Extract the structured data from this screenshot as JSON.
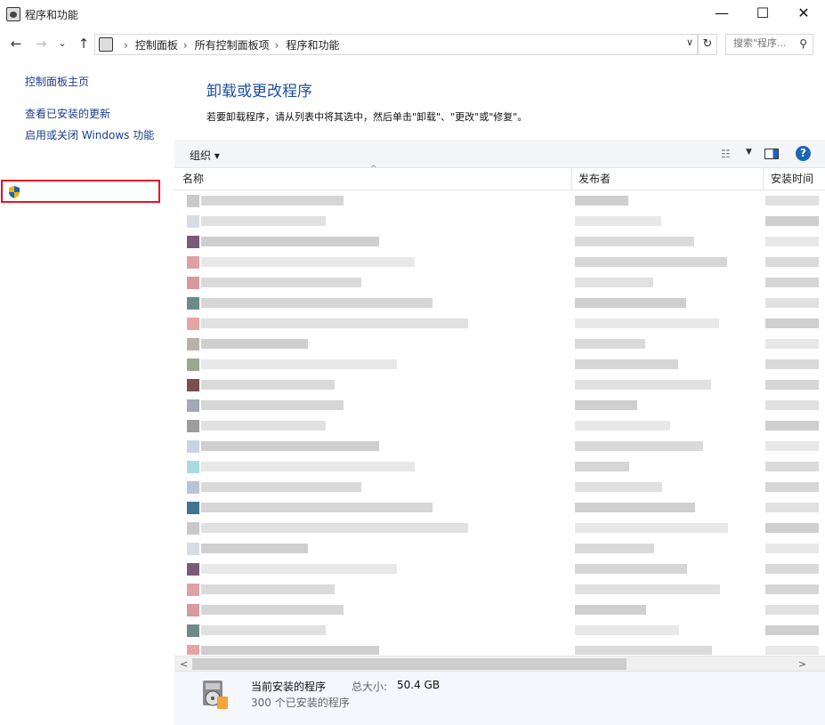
{
  "window": {
    "title": "程序和功能",
    "minimize_glyph": "—",
    "maximize_glyph": "☐",
    "close_glyph": "✕",
    "icon": "programs-features-icon"
  },
  "nav": {
    "back_glyph": "←",
    "forward_glyph": "→",
    "recent_glyph": "⌄",
    "up_glyph": "↑",
    "breadcrumb": [
      "控制面板",
      "所有控制面板项",
      "程序和功能"
    ],
    "crumb_separator": "›",
    "address_dropdown_glyph": "∨",
    "refresh_glyph": "↻",
    "search_placeholder": "搜索\"程序...",
    "search_glyph": "⚲"
  },
  "sidebar": {
    "home_link": "控制面板主页",
    "updates_link": "查看已安装的更新",
    "features_link": "启用或关闭 Windows 功能"
  },
  "main": {
    "heading": "卸载或更改程序",
    "description": "若要卸载程序，请从列表中将其选中，然后单击\"卸载\"、\"更改\"或\"修复\"。",
    "toolbar": {
      "organize_label": "组织 ▾",
      "view_glyph": "☷",
      "view_dropdown_glyph": "▼",
      "help_glyph": "?"
    },
    "columns": [
      "名称",
      "发布者",
      "安装时间"
    ],
    "sort_glyph": "^",
    "scroll_left_glyph": "<",
    "scroll_right_glyph": ">"
  },
  "details": {
    "title": "当前安装的程序",
    "size_label": "总大小:",
    "size_value": "50.4 GB",
    "count": "300 个已安装的程序"
  },
  "colors": {
    "highlight_border": "#e81123",
    "link": "#1a3c8e",
    "heading": "#1e4e9c",
    "details_bg": "#f4f7fc"
  }
}
